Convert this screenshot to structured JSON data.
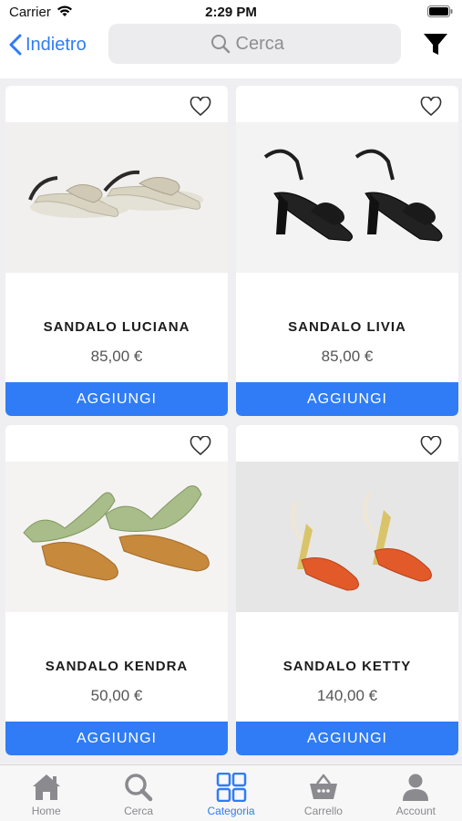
{
  "status_bar": {
    "carrier": "Carrier",
    "time": "2:29 PM"
  },
  "nav": {
    "back_label": "Indietro",
    "search_placeholder": "Cerca"
  },
  "products": [
    {
      "name": "SANDALO LUCIANA",
      "price": "85,00 €",
      "button": "AGGIUNGI",
      "image": "sandal-beige-flat"
    },
    {
      "name": "SANDALO LIVIA",
      "price": "85,00 €",
      "button": "AGGIUNGI",
      "image": "sandal-black-heel"
    },
    {
      "name": "SANDALO KENDRA",
      "price": "50,00 €",
      "button": "AGGIUNGI",
      "image": "sandal-green-thong"
    },
    {
      "name": "SANDALO KETTY",
      "price": "140,00 €",
      "button": "AGGIUNGI",
      "image": "sandal-orange-heel"
    }
  ],
  "tabs": [
    {
      "label": "Home",
      "icon": "home-icon"
    },
    {
      "label": "Cerca",
      "icon": "search-icon"
    },
    {
      "label": "Categoria",
      "icon": "grid-icon",
      "active": true
    },
    {
      "label": "Carrello",
      "icon": "basket-icon"
    },
    {
      "label": "Account",
      "icon": "person-icon"
    }
  ],
  "colors": {
    "accent": "#2f7cf6",
    "inactive": "#8a8a8f",
    "background": "#efeff2"
  }
}
